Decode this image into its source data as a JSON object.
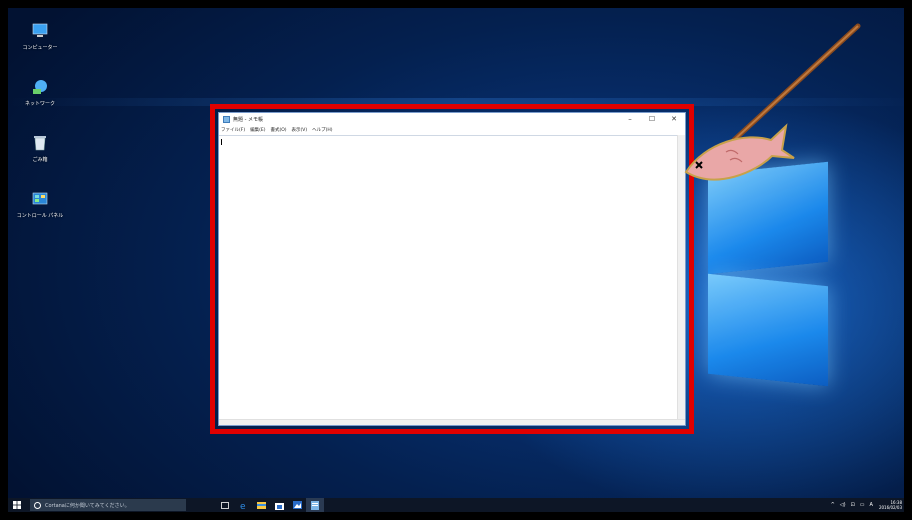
{
  "desktop": {
    "icons": [
      {
        "label": "コンピューター",
        "icon": "computer-icon"
      },
      {
        "label": "ネットワーク",
        "icon": "network-icon"
      },
      {
        "label": "ごみ箱",
        "icon": "recycle-bin-icon"
      },
      {
        "label": "コントロール パネル",
        "icon": "control-panel-icon"
      }
    ]
  },
  "notepad": {
    "title": "無題 - メモ帳",
    "menu": [
      "ファイル(F)",
      "編集(E)",
      "書式(O)",
      "表示(V)",
      "ヘルプ(H)"
    ],
    "buttons": {
      "minimize": "–",
      "maximize": "☐",
      "close": "✕"
    },
    "content": ""
  },
  "highlight_color": "#e00000",
  "taskbar": {
    "search_placeholder": "Cortanaに何か聞いてみてください。",
    "pinned": [
      "task-view-icon",
      "edge-icon",
      "file-explorer-icon",
      "store-icon",
      "photos-icon",
      "notepad-icon"
    ],
    "tray": {
      "chevron": "^",
      "volume": "◁)",
      "network": "⊡",
      "keyboard": "▭",
      "ime": "A"
    },
    "clock": {
      "time": "16:38",
      "date": "2016/02/03"
    }
  }
}
